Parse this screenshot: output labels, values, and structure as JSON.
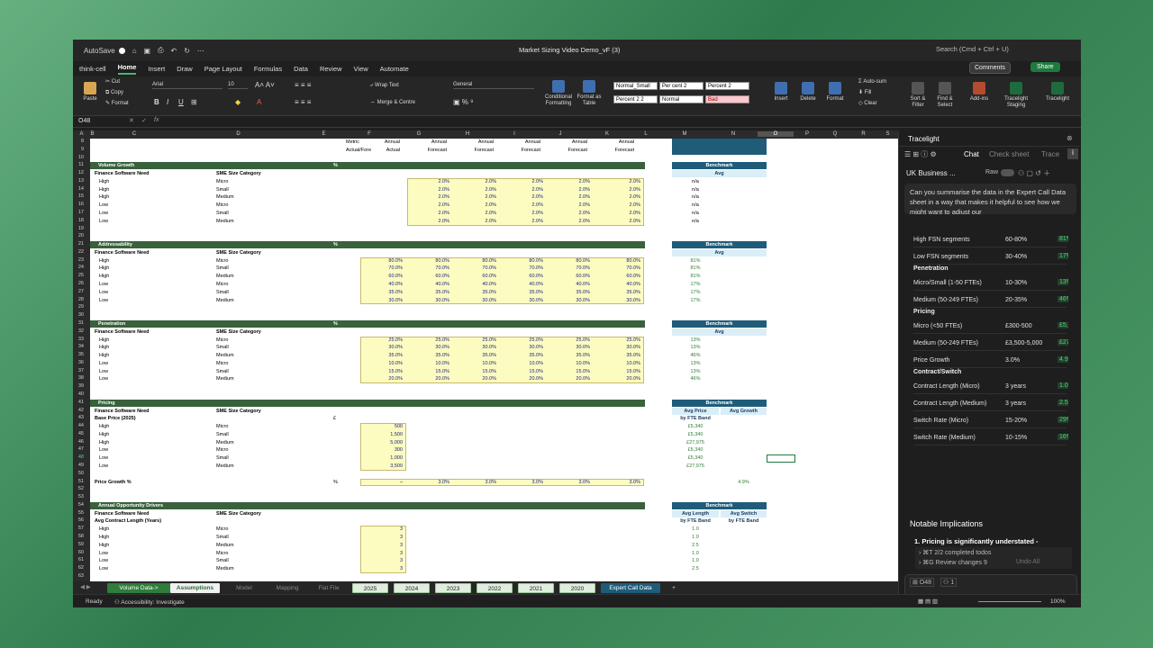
{
  "titlebar": {
    "autosave": "AutoSave",
    "title": "Market Sizing Video Demo_vF (3)",
    "search": "Search (Cmd + Ctrl + U)"
  },
  "tabs": [
    "think-cell",
    "Home",
    "Insert",
    "Draw",
    "Page Layout",
    "Formulas",
    "Data",
    "Review",
    "View",
    "Automate"
  ],
  "actions": {
    "comments": "Comments",
    "share": "Share"
  },
  "ribbon": {
    "paste": "Paste",
    "cut": "Cut",
    "copy": "Copy",
    "format": "Format",
    "font": "Arial",
    "size": "10",
    "wrap": "Wrap Text",
    "merge": "Merge & Centre",
    "number_format": "General",
    "cond_format": "Conditional Formatting",
    "format_table": "Format as Table",
    "styles": [
      "Normal_Small ...",
      "Per cent 2",
      "Percent 2",
      "Percent 2 2",
      "Normal",
      "Bad"
    ],
    "insert": "Insert",
    "delete": "Delete",
    "format_cells": "Format",
    "autosum": "Auto-sum",
    "fill": "Fill",
    "clear": "Clear",
    "sort": "Sort & Filter",
    "find": "Find & Select",
    "addins": "Add-ins",
    "tl_staging": "Tracelight Staging",
    "tracelight": "Tracelight"
  },
  "formula": {
    "cell": "O48",
    "fx": "fx"
  },
  "columns": [
    "A",
    "B",
    "C",
    "D",
    "E",
    "F",
    "G",
    "H",
    "I",
    "J",
    "K",
    "L",
    "M",
    "N",
    "O",
    "P",
    "Q",
    "R",
    "S"
  ],
  "rows": [
    "8",
    "9",
    "10",
    "11",
    "12",
    "13",
    "14",
    "15",
    "16",
    "17",
    "18",
    "19",
    "20",
    "21",
    "22",
    "23",
    "24",
    "25",
    "26",
    "27",
    "28",
    "29",
    "30",
    "31",
    "32",
    "33",
    "34",
    "35",
    "36",
    "37",
    "38",
    "39",
    "40",
    "41",
    "42",
    "43",
    "44",
    "45",
    "46",
    "47",
    "48",
    "49",
    "50",
    "51",
    "52",
    "53",
    "54",
    "55",
    "56",
    "57",
    "58",
    "59",
    "60",
    "61",
    "62",
    "63"
  ],
  "header8": {
    "metric": "Metric",
    "actual_fore": "Actual/Fore",
    "years_top": [
      "Annual",
      "Annual",
      "Annual",
      "Annual",
      "Annual",
      "Annual"
    ],
    "years_bot": [
      "Actual",
      "Forecast",
      "Forecast",
      "Forecast",
      "Forecast",
      "Forecast"
    ]
  },
  "labels": {
    "fsn": "Finance Software Need",
    "sme": "SME Size Category",
    "benchmark": "Benchmark",
    "avg": "Avg",
    "pct": "%",
    "gbp": "£",
    "avg_price": "Avg Price",
    "avg_growth": "Avg Growth",
    "by_fte": "by FTE Band",
    "base_price": "Base Price (2025)",
    "price_growth": "Price Growth %",
    "avg_contract": "Avg Contract Length (Years)",
    "avg_length": "Avg Length",
    "avg_switch": "Avg Switch"
  },
  "sections": [
    "Volume Growth",
    "Addressability",
    "Penetration",
    "Pricing",
    "Annual Opportunity Drivers"
  ],
  "need": [
    "High",
    "High",
    "High",
    "Low",
    "Low",
    "Low"
  ],
  "size": [
    "Micro",
    "Small",
    "Medium",
    "Micro",
    "Small",
    "Medium"
  ],
  "volume": {
    "values": [
      "2.0%",
      "2.0%",
      "2.0%",
      "2.0%",
      "2.0%",
      "2.0%"
    ],
    "bench": [
      "n/a",
      "n/a",
      "n/a",
      "n/a",
      "n/a",
      "n/a"
    ]
  },
  "address": {
    "values": [
      "80.0%",
      "70.0%",
      "60.0%",
      "40.0%",
      "35.0%",
      "30.0%"
    ],
    "bench": [
      "81%",
      "81%",
      "81%",
      "17%",
      "17%",
      "17%"
    ]
  },
  "penetration": {
    "values": [
      "25.0%",
      "30.0%",
      "35.0%",
      "10.0%",
      "15.0%",
      "20.0%"
    ],
    "bench": [
      "13%",
      "13%",
      "46%",
      "13%",
      "13%",
      "46%"
    ]
  },
  "pricing": {
    "values": [
      "500",
      "1,500",
      "5,000",
      "300",
      "1,000",
      "3,500"
    ],
    "bench": [
      "£5,340",
      "£5,340",
      "£27,975",
      "£5,340",
      "£5,340",
      "£27,975"
    ],
    "growth_first": "–",
    "growth": [
      "3.0%",
      "3.0%",
      "3.0%",
      "3.0%",
      "3.0%"
    ],
    "growth_bench": "4.9%"
  },
  "contract": {
    "values": [
      "3",
      "3",
      "3",
      "3",
      "3",
      "3"
    ],
    "bench": [
      "1.0",
      "1.0",
      "2.5",
      "1.0",
      "1.0",
      "2.5"
    ]
  },
  "sheets": [
    "Volume Data->",
    "Assumptions",
    "Model",
    "Mapping",
    "Flat File",
    "2025",
    "2024",
    "2023",
    "2022",
    "2021",
    "2020",
    "Expert Call Data",
    "+"
  ],
  "status": {
    "ready": "Ready",
    "accessibility": "Accessibility: Investigate",
    "zoom": "100%"
  },
  "panel": {
    "title": "Tracelight",
    "tabs": [
      "Chat",
      "Check sheet",
      "Trace"
    ],
    "doc": "UK Business ...",
    "raw": "Raw",
    "message": "Can you summarise the data in the Expert Call Data sheet in a way that makes it helpful to see how we might want to adjust our",
    "items": [
      {
        "h": "",
        "label": "High FSN segments",
        "range": "60-80%",
        "tag": "81%"
      },
      {
        "h": "",
        "label": "Low FSN segments",
        "range": "30-40%",
        "tag": "17%"
      },
      {
        "h": "Penetration",
        "label": "Micro/Small (1-50 FTEs)",
        "range": "10-30%",
        "tag": "13%"
      },
      {
        "h": "",
        "label": "Medium (50-249 FTEs)",
        "range": "20-35%",
        "tag": "46%"
      },
      {
        "h": "Pricing",
        "label": "Micro (<50 FTEs)",
        "range": "£300-500",
        "tag": "£5,3"
      },
      {
        "h": "",
        "label": "Medium (50-249 FTEs)",
        "range": "£3,500-5,000",
        "tag": "£27"
      },
      {
        "h": "",
        "label": "Price Growth",
        "range": "3.0%",
        "tag": "4.9%"
      },
      {
        "h": "Contract/Switch",
        "label": "Contract Length (Micro)",
        "range": "3 years",
        "tag": "1.0"
      },
      {
        "h": "",
        "label": "Contract Length (Medium)",
        "range": "3 years",
        "tag": "2.5"
      },
      {
        "h": "",
        "label": "Switch Rate (Micro)",
        "range": "15-20%",
        "tag": "29%"
      },
      {
        "h": "",
        "label": "Switch Rate (Medium)",
        "range": "10-15%",
        "tag": "16%"
      }
    ],
    "notable": "Notable Implications",
    "notable_item": "1.  Pricing is significantly understated -",
    "todos": "2/2 completed todos",
    "review": "Review changes 9",
    "undo": "Undo All",
    "ref_cell": "O48",
    "ref_count": "1",
    "placeholder": "Type message, / for workflows",
    "control": "Control",
    "model": "Cl...",
    "stop": "Stop"
  },
  "colors": {
    "band": "#38613c",
    "bench": "#1f5c7a",
    "input": "#fdfcc0",
    "accent": "#4fb36f"
  }
}
